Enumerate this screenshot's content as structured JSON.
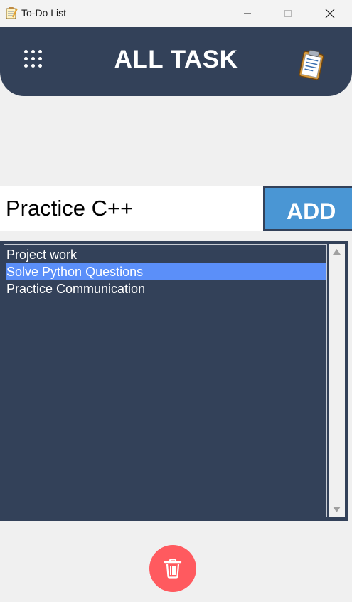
{
  "window": {
    "title": "To-Do List",
    "icons": {
      "app": "notepad-icon",
      "minimize": "minimize-icon",
      "maximize": "maximize-icon",
      "close": "close-icon"
    }
  },
  "header": {
    "title": "ALL TASK",
    "menu_icon": "grid-menu-icon",
    "logo_icon": "clipboard-icon",
    "background": "#334159"
  },
  "entry": {
    "value": "Practice C++",
    "add_label": "ADD",
    "add_color": "#4a96d4"
  },
  "tasks": {
    "items": [
      "Project work",
      "Solve Python Questions",
      "Practice Communication"
    ],
    "selected_index": 1,
    "selection_color": "#5b8ff9"
  },
  "delete": {
    "icon": "trash-icon",
    "color": "#ff5a5f"
  }
}
